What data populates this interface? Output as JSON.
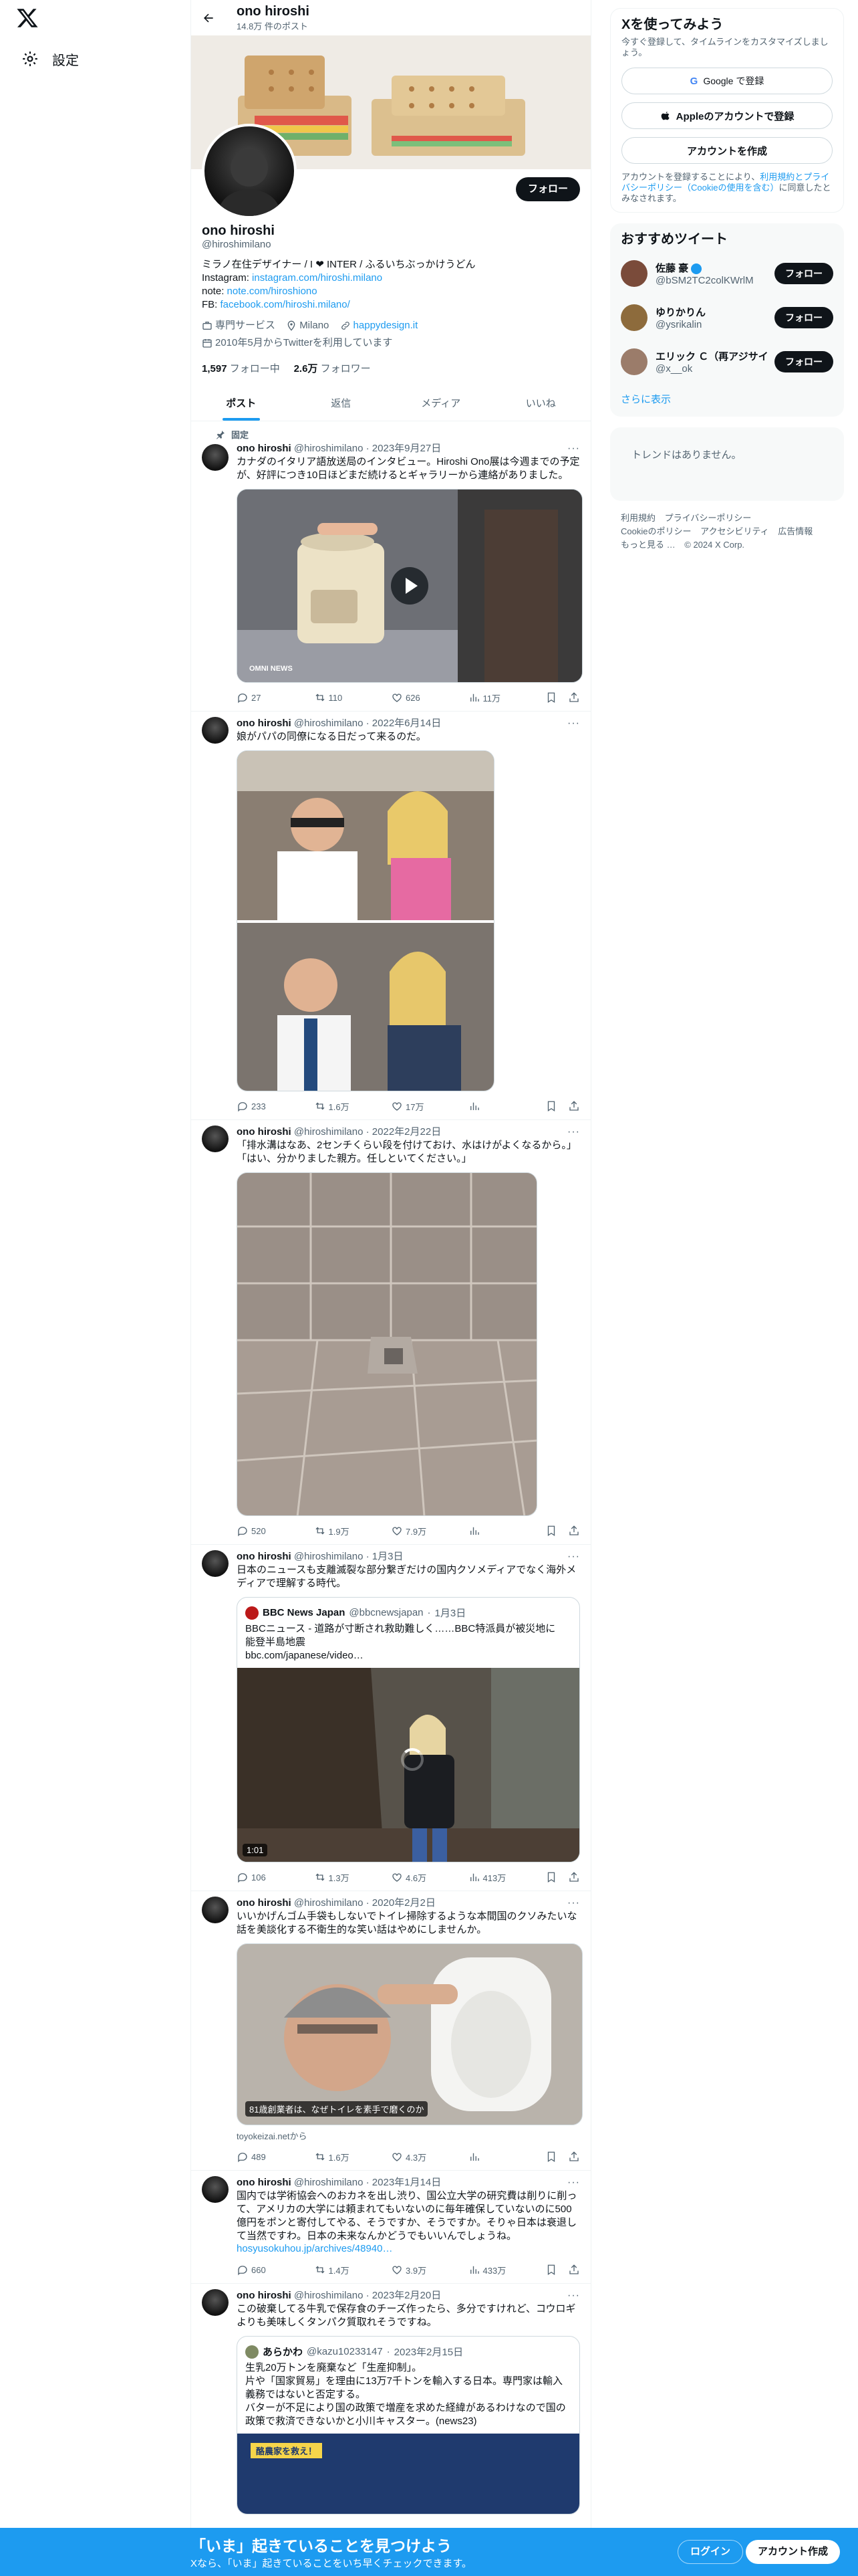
{
  "nav": {
    "settings_label": "設定"
  },
  "header": {
    "name": "ono hiroshi",
    "post_count": "14.8万 件のポスト"
  },
  "profile": {
    "name": "ono hiroshi",
    "handle": "@hiroshimilano",
    "follow_label": "フォロー",
    "bio_line1": "ミラノ在住デザイナー / I ❤ INTER / ふるいちぶっかけうどん",
    "instagram_label": "Instagram: ",
    "instagram_link": "instagram.com/hiroshi.milano",
    "note_label": "note: ",
    "note_link": "note.com/hiroshiono",
    "fb_label": "FB: ",
    "fb_link": "facebook.com/hiroshi.milano/",
    "category": "専門サービス",
    "location": "Milano",
    "website": "happydesign.it",
    "joined": "2010年5月からTwitterを利用しています",
    "following_count": "1,597",
    "following_label": "フォロー中",
    "followers_count": "2.6万",
    "followers_label": "フォロワー"
  },
  "tabs": [
    "ポスト",
    "返信",
    "メディア",
    "いいね"
  ],
  "pinned_label": "固定",
  "tweets": [
    {
      "name": "ono hiroshi",
      "handle": "@hiroshimilano",
      "date": "2023年9月27日",
      "text": "カナダのイタリア語放送局のインタビュー。Hiroshi Ono展は今週までの予定が、好評につき10日ほどまだ続けるとギャラリーから連絡がありました。",
      "replies": "27",
      "reposts": "110",
      "likes": "626",
      "views": "11万",
      "media_caption": "OMNI NEWS"
    },
    {
      "name": "ono hiroshi",
      "handle": "@hiroshimilano",
      "date": "2022年6月14日",
      "text": "娘がパパの同僚になる日だって来るのだ。",
      "replies": "233",
      "reposts": "1.6万",
      "likes": "17万",
      "views": ""
    },
    {
      "name": "ono hiroshi",
      "handle": "@hiroshimilano",
      "date": "2022年2月22日",
      "text": "「排水溝はなあ、2センチくらい段を付けておけ、水はけがよくなるから。」\n「はい、分かりました親方。任しといてください。」",
      "replies": "520",
      "reposts": "1.9万",
      "likes": "7.9万",
      "views": ""
    },
    {
      "name": "ono hiroshi",
      "handle": "@hiroshimilano",
      "date": "1月3日",
      "text": "日本のニュースも支離滅裂な部分繋ぎだけの国内クソメディアでなく海外メディアで理解する時代。",
      "quote_name": "BBC News Japan",
      "quote_handle": "@bbcnewsjapan",
      "quote_date": "1月3日",
      "quote_text": "BBCニュース - 道路が寸断され救助難しく……BBC特派員が被災地に　能登半島地震\nbbc.com/japanese/video…",
      "video_time": "1:01",
      "replies": "106",
      "reposts": "1.3万",
      "likes": "4.6万",
      "views": "413万"
    },
    {
      "name": "ono hiroshi",
      "handle": "@hiroshimilano",
      "date": "2020年2月2日",
      "text": "いいかげんゴム手袋もしないでトイレ掃除するような本間国のクソみたいな話を美談化する不衛生的な笑い話はやめにしませんか。",
      "media_caption": "81歳創業者は、なぜトイレを素手で磨くのか",
      "source": "toyokeizai.netから",
      "replies": "489",
      "reposts": "1.6万",
      "likes": "4.3万",
      "views": ""
    },
    {
      "name": "ono hiroshi",
      "handle": "@hiroshimilano",
      "date": "2023年1月14日",
      "text": "国内では学術協会へのおカネを出し渋り、国公立大学の研究費は削りに削って、アメリカの大学には頼まれてもいないのに毎年確保していないのに500億円をポンと寄付してやる、そうですか、そうですか。そりゃ日本は衰退して当然ですわ。日本の未来なんかどうでもいいんでしょうね。",
      "link": "hosyusokuhou.jp/archives/48940…",
      "replies": "660",
      "reposts": "1.4万",
      "likes": "3.9万",
      "views": "433万"
    },
    {
      "name": "ono hiroshi",
      "handle": "@hiroshimilano",
      "date": "2023年2月20日",
      "text": "この破棄してる牛乳で保存食のチーズ作ったら、多分ですけれど、コウロギよりも美味しくタンパク質取れそうですね。",
      "quote_name": "あらかわ",
      "quote_handle": "@kazu10233147",
      "quote_date": "2023年2月15日",
      "quote_text": "生乳20万トンを廃棄など「生産抑制」。\n片や「国家貿易」を理由に13万7千トンを輸入する日本。専門家は輸入義務ではないと否定する。\nバターが不足により国の政策で増産を求めた経緯があるわけなので国の政策で救済できないかと小川キャスター。(news23)",
      "quote_media_caption": "酪農家を救え！"
    }
  ],
  "right": {
    "signup_title": "Xを使ってみよう",
    "signup_desc": "今すぐ登録して、タイムラインをカスタマイズしましょう。",
    "google_label": "Google で登録",
    "apple_label": "Appleのアカウントで登録",
    "create_label": "アカウントを作成",
    "terms_prefix": "アカウントを登録することにより、",
    "terms_link": "利用規約とプライバシーポリシー（Cookieの使用を含む）",
    "terms_suffix": "に同意したとみなされます。",
    "reco_title": "おすすめツイート",
    "reco": [
      {
        "name": "佐藤 豪",
        "handle": "@bSM2TC2colKWrlM",
        "color": "#7a4b3a"
      },
      {
        "name": "ゆりかりん",
        "handle": "@ysrikalin",
        "color": "#8d6b3c"
      },
      {
        "name": "エリック Ｃ（再アジサイ",
        "handle": "@x__ok",
        "color": "#9b7c6a"
      }
    ],
    "reco_follow": "フォロー",
    "show_more": "さらに表示",
    "trend_empty": "トレンドはありません。",
    "footer": [
      "利用規約",
      "プライバシーポリシー",
      "Cookieのポリシー",
      "アクセシビリティ",
      "広告情報",
      "もっと見る …",
      "© 2024 X Corp."
    ]
  },
  "bottom": {
    "title": "「いま」起きていることを見つけよう",
    "sub": "Xなら、「いま」起きていることをいち早くチェックできます。",
    "login": "ログイン",
    "signup": "アカウント作成"
  },
  "colors": {
    "accent": "#1d9bf0",
    "text": "#0f1419",
    "muted": "#536471",
    "like_red": "#f91880"
  }
}
